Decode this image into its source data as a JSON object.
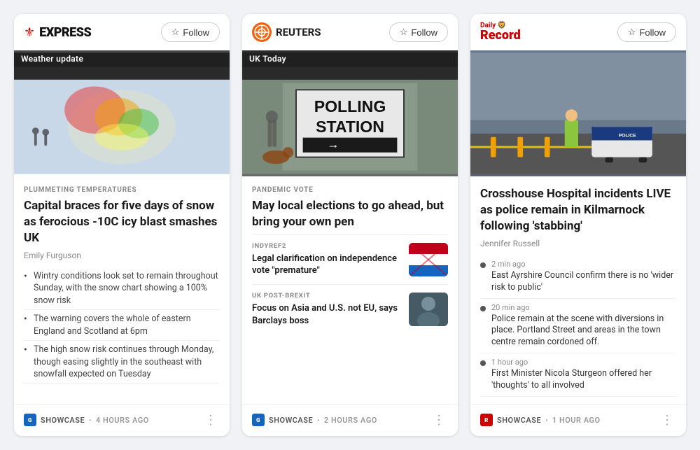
{
  "cards": [
    {
      "id": "express",
      "source_name": "EXPRESS",
      "follow_label": "Follow",
      "image_label": "Weather update",
      "category": "PLUMMETING TEMPERATURES",
      "headline": "Capital braces for five days of snow as ferocious -10C icy blast smashes UK",
      "author": "Emily Furguson",
      "bullets": [
        "Wintry conditions look set to remain throughout Sunday, with the snow chart showing a 100% snow risk",
        "The warning covers the whole of eastern England and Scotland at 6pm",
        "The high snow risk continues through Monday, though easing slightly in the southeast with snowfall expected on Tuesday"
      ],
      "footer_source": "SHOWCASE",
      "footer_time": "4 hours ago"
    },
    {
      "id": "reuters",
      "source_name": "REUTERS",
      "follow_label": "Follow",
      "image_label": "UK Today",
      "category": "PANDEMIC VOTE",
      "headline": "May local elections to go ahead, but bring your own pen",
      "sub_articles": [
        {
          "category": "INDYREF2",
          "title": "Legal clarification on independence vote \"premature\"",
          "thumb": "flags"
        },
        {
          "category": "UK POST-BREXIT",
          "title": "Focus on Asia and U.S. not EU, says Barclays boss",
          "thumb": "person"
        }
      ],
      "footer_source": "SHOWCASE",
      "footer_time": "2 hours ago"
    },
    {
      "id": "daily-record",
      "source_name": "Daily Record",
      "follow_label": "Follow",
      "headline": "Crosshouse Hospital incidents LIVE as police remain in Kilmarnock following 'stabbing'",
      "author": "Jennifer Russell",
      "live_updates": [
        {
          "time": "2 min ago",
          "text": "East Ayrshire Council confirm there is no 'wider risk to public'"
        },
        {
          "time": "20 min ago",
          "text": "Police remain at the scene with diversions in place. Portland Street and areas in the town centre remain cordoned off."
        },
        {
          "time": "1 hour ago",
          "text": "First Minister Nicola Sturgeon offered her 'thoughts' to all involved"
        }
      ],
      "footer_source": "SHOWCASE",
      "footer_time": "1 hour ago"
    }
  ]
}
